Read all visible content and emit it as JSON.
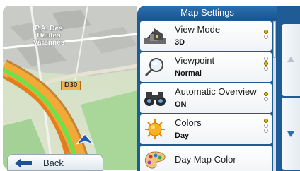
{
  "map": {
    "place_label": "P.A. Des\nHautes\nVarennes",
    "road_label": "D30"
  },
  "back_button": {
    "label": "Back"
  },
  "panel": {
    "title": "Map Settings",
    "rows": [
      {
        "title": "View Mode",
        "value": "3D",
        "icon": "house-3d-icon",
        "option_index": 0,
        "option_count": 2
      },
      {
        "title": "Viewpoint",
        "value": "Normal",
        "icon": "magnifier-icon",
        "option_index": 1,
        "option_count": 3
      },
      {
        "title": "Automatic Overview",
        "value": "ON",
        "icon": "binoculars-icon",
        "option_index": 0,
        "option_count": 2
      },
      {
        "title": "Colors",
        "value": "Day",
        "icon": "sun-icon",
        "option_index": 0,
        "option_count": 3
      },
      {
        "title": "Day Map Color",
        "icon": "palette-icon"
      }
    ]
  },
  "colors": {
    "panel_blue": "#1f5b95",
    "selected_dot": "#e9b100",
    "route_orange": "#f09a1b",
    "route_green": "#6fe04b"
  }
}
